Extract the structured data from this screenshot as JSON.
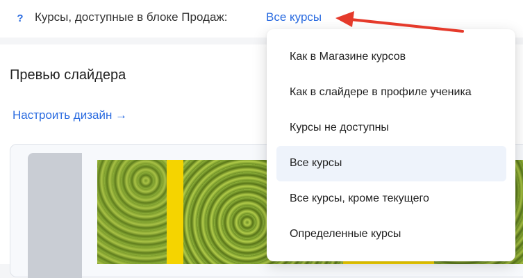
{
  "header": {
    "help_icon": "?",
    "setting_label": "Курсы, доступные в блоке Продаж:",
    "setting_value": "Все курсы"
  },
  "preview": {
    "title": "Превью слайдера",
    "design_link": "Настроить дизайн →"
  },
  "dropdown": {
    "selected": "Все курсы",
    "options": [
      "Как в Магазине курсов",
      "Как в слайдере в профиле ученика",
      "Курсы не доступны",
      "Все курсы",
      "Все курсы, кроме текущего",
      "Определенные курсы"
    ]
  },
  "colors": {
    "link": "#2a6be0",
    "arrow": "#e53a2b",
    "selected_bg": "#eef3fb",
    "slide_frame": "#f5d400"
  }
}
